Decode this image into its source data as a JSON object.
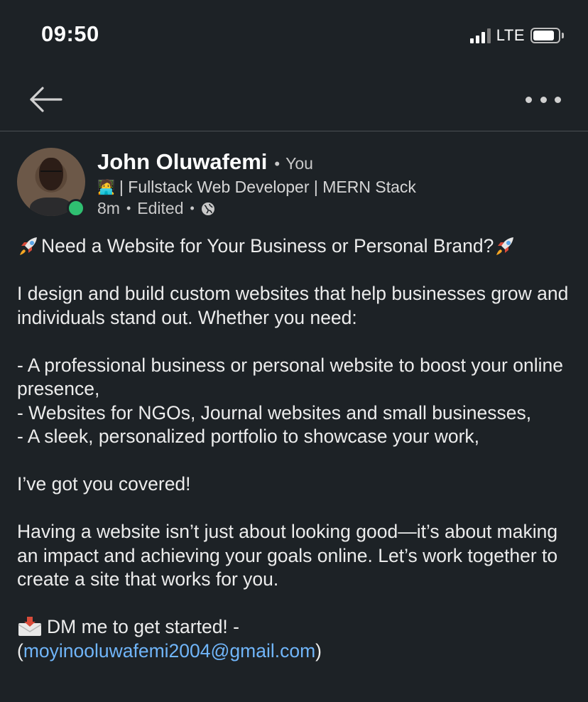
{
  "status_bar": {
    "time": "09:50",
    "network": "LTE",
    "battery_level": 0.85,
    "signal_bars": 3
  },
  "nav": {
    "back_icon": "back-arrow-icon",
    "more_icon": "more-horizontal-icon"
  },
  "post": {
    "author": {
      "name": "John Oluwafemi",
      "relation": "You",
      "headline_emoji": "🧑‍💻",
      "headline": "| Fullstack Web Developer | MERN Stack",
      "time": "8m",
      "edited": "Edited",
      "visibility_icon": "globe-icon",
      "online": true
    },
    "body": {
      "title": "Need a Website for Your Business or Personal Brand?",
      "intro": "I design and build custom websites that help businesses grow and individuals stand out. Whether you need:",
      "bullets": [
        "- A professional business or personal website to boost your online presence,",
        "- Websites for NGOs, Journal websites and small businesses,",
        "- A sleek, personalized portfolio to showcase your work,"
      ],
      "covered": "I’ve got you covered!",
      "closing": "Having a website isn’t just about looking good—it’s about making an impact and achieving your goals online. Let’s work together to create a site that works for you.",
      "cta_prefix": "DM me to get started! -",
      "cta_open": "(",
      "email": "moyinooluwafemi2004@gmail.com",
      "cta_close": ")"
    }
  },
  "colors": {
    "background": "#1d2226",
    "link": "#70b5f9",
    "online": "#2fbf71",
    "divider": "#4a4f54"
  }
}
